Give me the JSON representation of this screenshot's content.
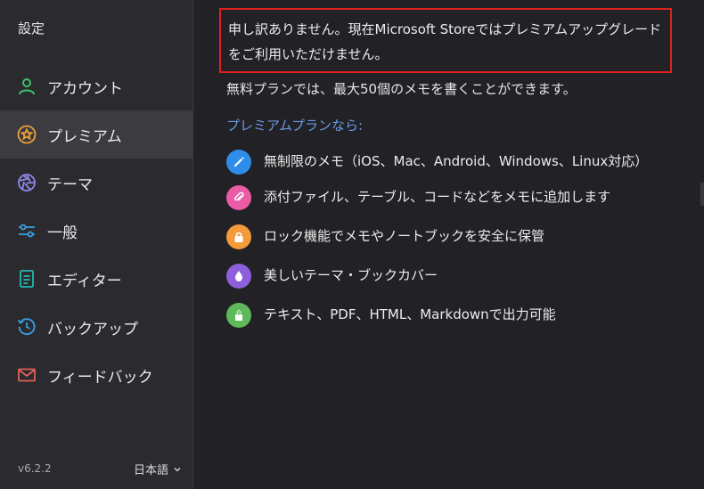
{
  "sidebar": {
    "title": "設定",
    "items": [
      {
        "label": "アカウント",
        "icon": "person-icon",
        "color": "#3ec06e"
      },
      {
        "label": "プレミアム",
        "icon": "premium-badge-icon",
        "color": "#f0a13a"
      },
      {
        "label": "テーマ",
        "icon": "aperture-icon",
        "color": "#8f86e8"
      },
      {
        "label": "一般",
        "icon": "sliders-icon",
        "color": "#3aa0e6"
      },
      {
        "label": "エディター",
        "icon": "document-icon",
        "color": "#26b7b0"
      },
      {
        "label": "バックアップ",
        "icon": "history-icon",
        "color": "#3aa0e6"
      },
      {
        "label": "フィードバック",
        "icon": "mail-icon",
        "color": "#e2605a"
      }
    ],
    "version": "v6.2.2",
    "language": "日本語"
  },
  "main": {
    "notice": "申し訳ありません。現在Microsoft Storeではプレミアムアップグレードをご利用いただけません。",
    "free_text": "無料プランでは、最大50個のメモを書くことができます。",
    "premium_heading": "プレミアムプランなら:",
    "features": [
      {
        "text": "無制限のメモ（iOS、Mac、Android、Windows、Linux対応）",
        "icon": "pencil-icon",
        "color": "#2e8de8"
      },
      {
        "text": "添付ファイル、テーブル、コードなどをメモに追加します",
        "icon": "paperclip-icon",
        "color": "#ec5ba6"
      },
      {
        "text": "ロック機能でメモやノートブックを安全に保管",
        "icon": "lock-icon",
        "color": "#f39a3a"
      },
      {
        "text": "美しいテーマ・ブックカバー",
        "icon": "droplet-icon",
        "color": "#8e5fdc"
      },
      {
        "text": "テキスト、PDF、HTML、Markdownで出力可能",
        "icon": "export-icon",
        "color": "#5fb85a"
      }
    ]
  }
}
